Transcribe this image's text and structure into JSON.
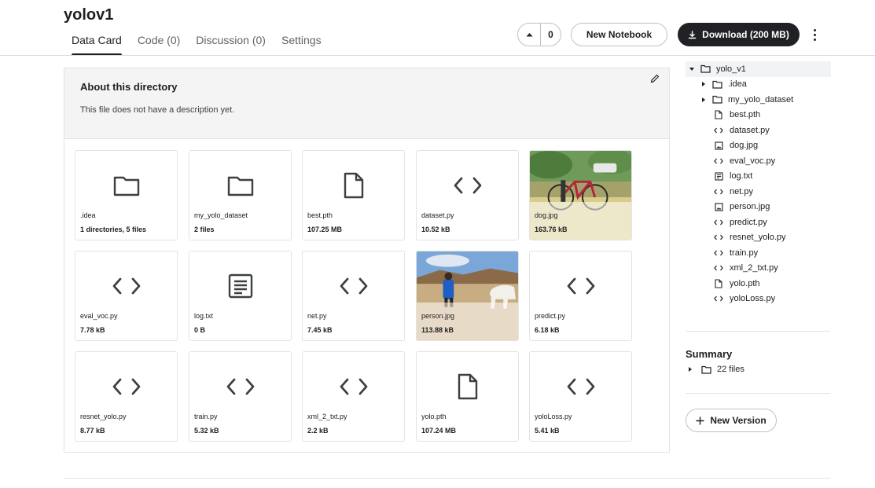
{
  "header": {
    "title": "yolov1",
    "tabs": [
      {
        "label": "Data Card",
        "active": true
      },
      {
        "label": "Code (0)"
      },
      {
        "label": "Discussion (0)"
      },
      {
        "label": "Settings"
      }
    ],
    "vote_count": "0",
    "new_notebook_label": "New Notebook",
    "download_label": "Download (200 MB)"
  },
  "about": {
    "heading": "About this directory",
    "description": "This file does not have a description yet."
  },
  "cards": [
    {
      "name": ".idea",
      "meta": "1 directories, 5 files",
      "icon": "folder-icon"
    },
    {
      "name": "my_yolo_dataset",
      "meta": "2 files",
      "icon": "folder-icon"
    },
    {
      "name": "best.pth",
      "meta": "107.25 MB",
      "icon": "file-icon"
    },
    {
      "name": "dataset.py",
      "meta": "10.52 kB",
      "icon": "code-icon"
    },
    {
      "name": "dog.jpg",
      "meta": "163.76 kB",
      "icon": "image-thumbnail"
    },
    {
      "name": "eval_voc.py",
      "meta": "7.78 kB",
      "icon": "code-icon"
    },
    {
      "name": "log.txt",
      "meta": "0 B",
      "icon": "text-file-icon"
    },
    {
      "name": "net.py",
      "meta": "7.45 kB",
      "icon": "code-icon"
    },
    {
      "name": "person.jpg",
      "meta": "113.88 kB",
      "icon": "image-thumbnail"
    },
    {
      "name": "predict.py",
      "meta": "6.18 kB",
      "icon": "code-icon"
    },
    {
      "name": "resnet_yolo.py",
      "meta": "8.77 kB",
      "icon": "code-icon"
    },
    {
      "name": "train.py",
      "meta": "5.32 kB",
      "icon": "code-icon"
    },
    {
      "name": "xml_2_txt.py",
      "meta": "2.2 kB",
      "icon": "code-icon"
    },
    {
      "name": "yolo.pth",
      "meta": "107.24 MB",
      "icon": "file-icon"
    },
    {
      "name": "yoloLoss.py",
      "meta": "5.41 kB",
      "icon": "code-icon"
    }
  ],
  "tree": {
    "root": "yolo_v1",
    "items": [
      {
        "label": ".idea",
        "icon": "folder-icon",
        "expandable": true
      },
      {
        "label": "my_yolo_dataset",
        "icon": "folder-icon",
        "expandable": true
      },
      {
        "label": "best.pth",
        "icon": "file-icon"
      },
      {
        "label": "dataset.py",
        "icon": "code-icon"
      },
      {
        "label": "dog.jpg",
        "icon": "image-icon"
      },
      {
        "label": "eval_voc.py",
        "icon": "code-icon"
      },
      {
        "label": "log.txt",
        "icon": "text-file-icon"
      },
      {
        "label": "net.py",
        "icon": "code-icon"
      },
      {
        "label": "person.jpg",
        "icon": "image-icon"
      },
      {
        "label": "predict.py",
        "icon": "code-icon"
      },
      {
        "label": "resnet_yolo.py",
        "icon": "code-icon"
      },
      {
        "label": "train.py",
        "icon": "code-icon"
      },
      {
        "label": "xml_2_txt.py",
        "icon": "code-icon"
      },
      {
        "label": "yolo.pth",
        "icon": "file-icon"
      },
      {
        "label": "yoloLoss.py",
        "icon": "code-icon"
      }
    ]
  },
  "summary": {
    "title": "Summary",
    "files_label": "22 files"
  },
  "new_version_label": "New Version",
  "colors": {
    "text": "#202124",
    "border": "#e3e3e3",
    "panel_bg": "#f4f4f5",
    "icon": "#3c4043"
  }
}
